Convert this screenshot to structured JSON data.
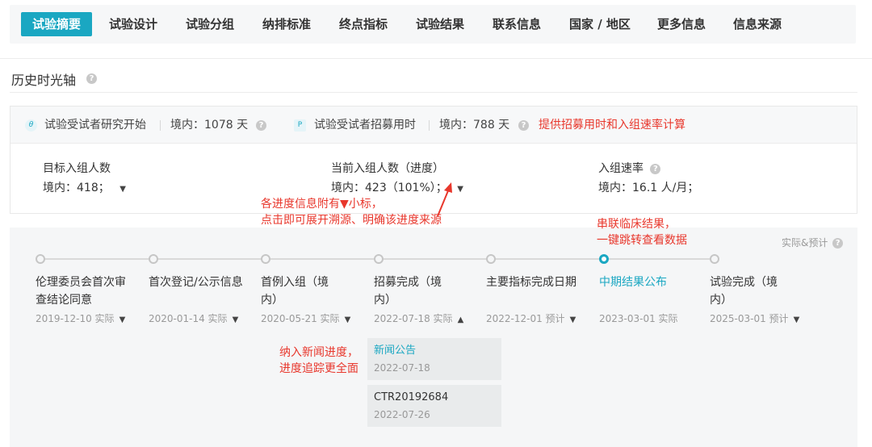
{
  "tabs": [
    "试验摘要",
    "试验设计",
    "试验分组",
    "纳排标准",
    "终点指标",
    "试验结果",
    "联系信息",
    "国家 / 地区",
    "更多信息",
    "信息来源"
  ],
  "section": {
    "title": "历史时光轴",
    "help_icon": "question-icon"
  },
  "summary": {
    "study_start_label": "试验受试者研究开始",
    "study_start_value": "境内：1078 天",
    "recruit_label": "试验受试者招募用时",
    "recruit_value": "境内：788 天",
    "note": "提供招募用时和入组速率计算",
    "target_label": "目标入组人数",
    "target_value": "境内：418；",
    "current_label": "当前入组人数（进度）",
    "current_value": "境内：423（101%）；",
    "rate_label": "入组速率",
    "rate_value": "境内：16.1 人/月；"
  },
  "annotations": {
    "progress_line1": "各进度信息附有▼小标，",
    "progress_line2": "点击即可展开溯源、明确该进度来源",
    "results_line1": "串联临床结果，",
    "results_line2": "一键跳转查看数据",
    "news_line1": "纳入新闻进度，",
    "news_line2": "进度追踪更全面"
  },
  "legend": "实际&预计",
  "milestones": [
    {
      "name": "伦理委员会首次审查结论同意",
      "date": "2019-12-10 实际",
      "caret": "▼"
    },
    {
      "name": "首次登记/公示信息",
      "date": "2020-01-14 实际",
      "caret": "▼"
    },
    {
      "name": "首例入组（境内）",
      "date": "2020-05-21 实际",
      "caret": "▼"
    },
    {
      "name": "招募完成（境内）",
      "date": "2022-07-18 实际",
      "caret": "▲"
    },
    {
      "name": "主要指标完成日期",
      "date": "2022-12-01 预计",
      "caret": "▼"
    },
    {
      "name": "中期结果公布",
      "date": "2023-03-01 实际",
      "caret": ""
    },
    {
      "name": "试验完成（境内）",
      "date": "2025-03-01 预计",
      "caret": "▼"
    }
  ],
  "sources": [
    {
      "title": "新闻公告",
      "date": "2022-07-18"
    },
    {
      "title": "CTR20192684",
      "date": "2022-07-26"
    }
  ],
  "colors": {
    "accent": "#1aa7c2",
    "annotation": "#e8372c"
  }
}
